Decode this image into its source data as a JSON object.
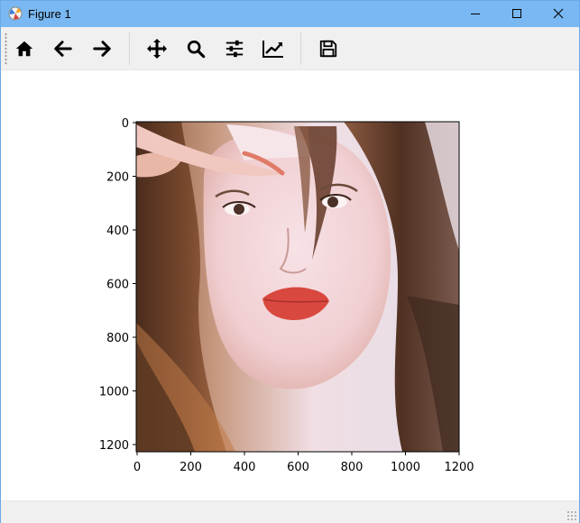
{
  "window": {
    "title": "Figure 1",
    "controls": [
      "minimize",
      "maximize",
      "close"
    ]
  },
  "toolbar": {
    "tools": [
      {
        "name": "home-button",
        "icon": "home-icon",
        "tooltip": "Reset original view"
      },
      {
        "name": "back-button",
        "icon": "arrow-left-icon",
        "tooltip": "Back to previous view"
      },
      {
        "name": "forward-button",
        "icon": "arrow-right-icon",
        "tooltip": "Forward to next view"
      },
      {
        "name": "pan-button",
        "icon": "move-icon",
        "tooltip": "Pan axes"
      },
      {
        "name": "zoom-button",
        "icon": "magnifier-icon",
        "tooltip": "Zoom to rectangle"
      },
      {
        "name": "subplots-button",
        "icon": "sliders-icon",
        "tooltip": "Configure subplots"
      },
      {
        "name": "customize-button",
        "icon": "line-chart-icon",
        "tooltip": "Edit axis, curve and image parameters"
      },
      {
        "name": "save-button",
        "icon": "floppy-disk-icon",
        "tooltip": "Save the figure"
      }
    ]
  },
  "plot": {
    "content": "photograph of a woman with long brown hair",
    "x_ticks": [
      "0",
      "200",
      "400",
      "600",
      "800",
      "1000",
      "1200"
    ],
    "y_ticks": [
      "0",
      "200",
      "400",
      "600",
      "800",
      "1000",
      "1200"
    ],
    "x_range": [
      0,
      1200
    ],
    "y_range": [
      0,
      1230
    ],
    "y_inverted": true
  },
  "colors": {
    "titlebar": "#79b8f2",
    "toolbar": "#f0f0f0",
    "hair": "#5a3a28",
    "skin": "#f1d3d6",
    "lips": "#d9483f"
  }
}
